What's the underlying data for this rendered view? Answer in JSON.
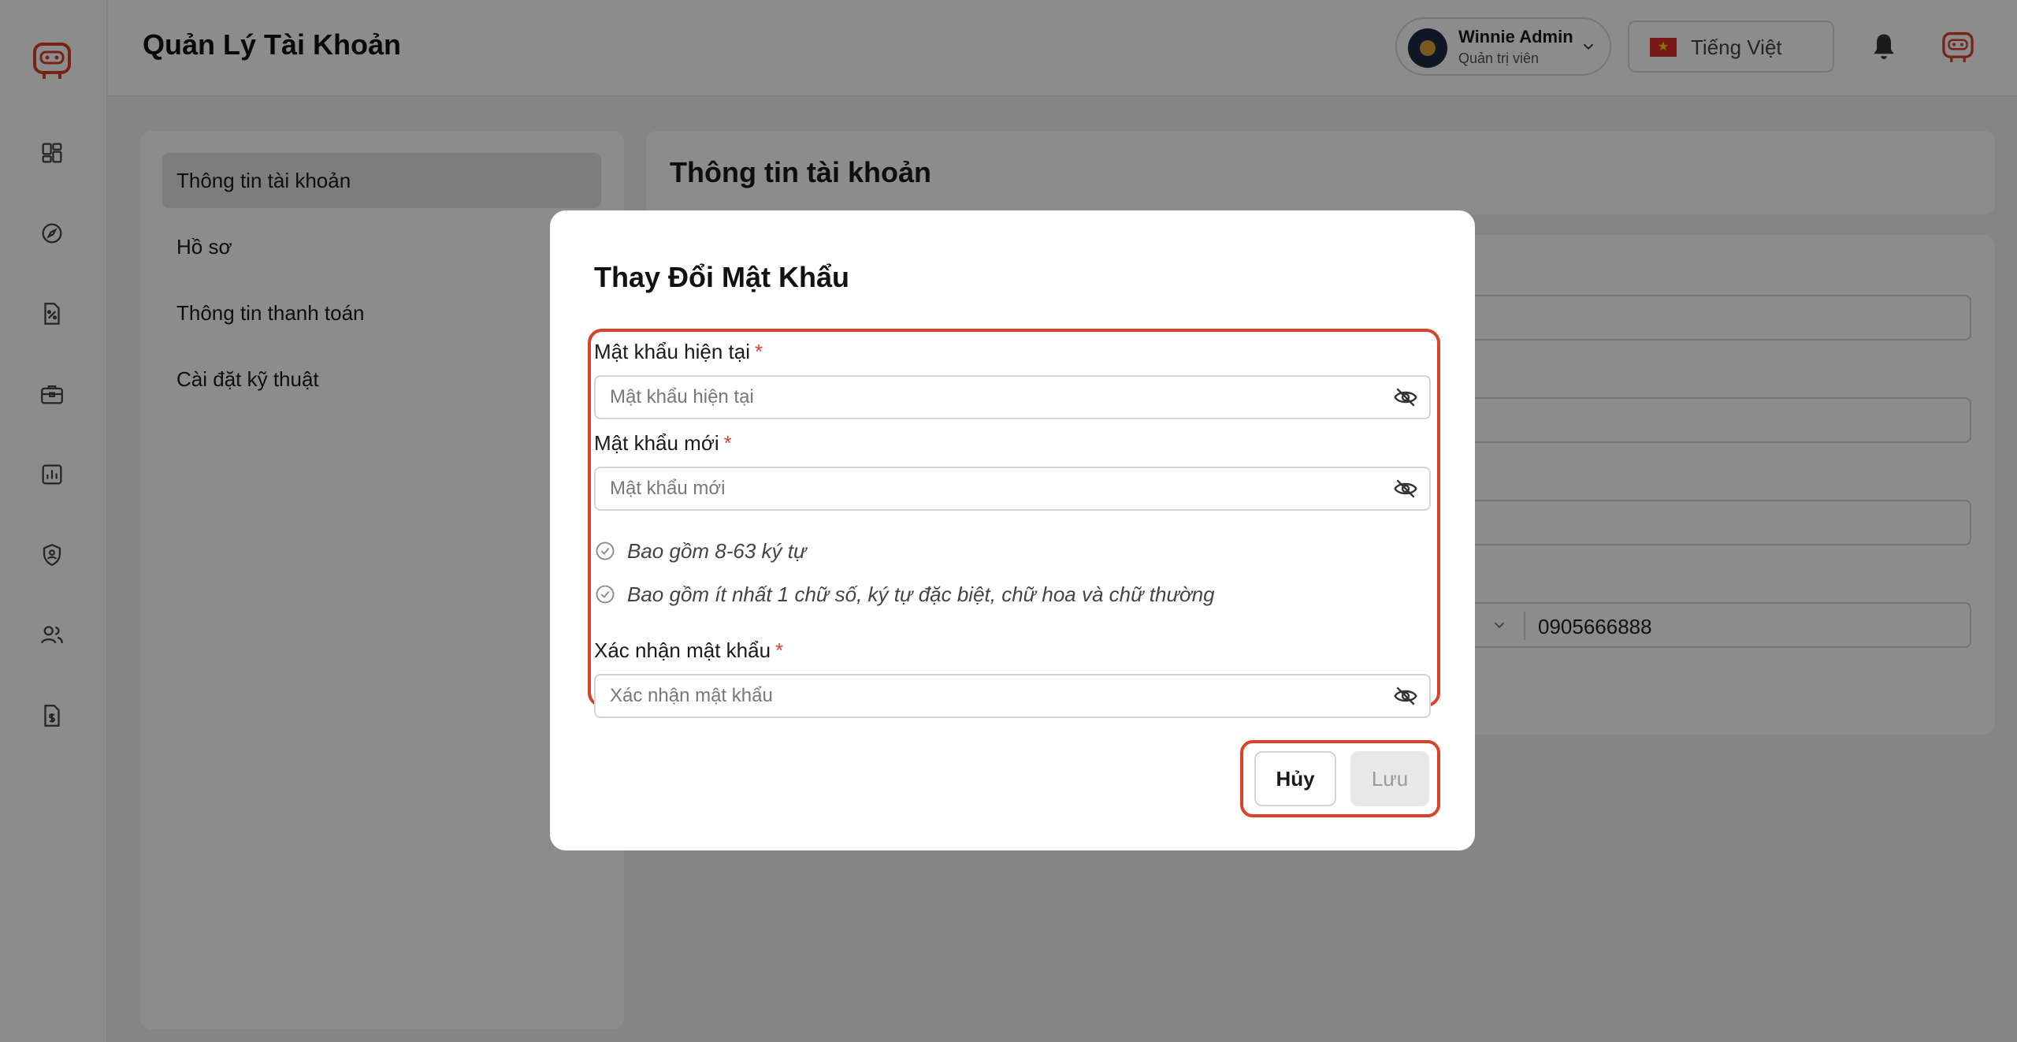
{
  "header": {
    "title": "Quản Lý Tài Khoản",
    "user": {
      "name": "Winnie Admin",
      "role": "Quản trị viên"
    },
    "language": "Tiếng Việt"
  },
  "sidebar": {
    "icons": [
      "dashboard-icon",
      "compass-icon",
      "discount-document-icon",
      "briefcase-icon",
      "report-chart-icon",
      "shield-user-icon",
      "users-icon",
      "invoice-icon"
    ]
  },
  "settings_menu": {
    "items": [
      {
        "label": "Thông tin tài khoản",
        "active": true
      },
      {
        "label": "Hồ sơ",
        "active": false
      },
      {
        "label": "Thông tin thanh toán",
        "active": false
      },
      {
        "label": "Cài đặt kỹ thuật",
        "active": false
      }
    ]
  },
  "content": {
    "title": "Thông tin tài khoản",
    "phone_value": "0905666888"
  },
  "modal": {
    "title": "Thay Đổi Mật Khẩu",
    "current_password": {
      "label": "Mật khẩu hiện tại",
      "required_mark": "*",
      "placeholder": "Mật khẩu hiện tại",
      "value": ""
    },
    "new_password": {
      "label": "Mật khẩu mới",
      "required_mark": "*",
      "placeholder": "Mật khẩu mới",
      "value": ""
    },
    "rules": [
      "Bao gồm 8-63 ký tự",
      "Bao gồm ít nhất 1 chữ số, ký tự đặc biệt, chữ hoa và chữ thường"
    ],
    "confirm_password": {
      "label": "Xác nhận mật khẩu",
      "required_mark": "*",
      "placeholder": "Xác nhận mật khẩu",
      "value": ""
    },
    "cancel_label": "Hủy",
    "save_label": "Lưu"
  },
  "colors": {
    "accent_red": "#d9432a",
    "overlay": "rgba(0,0,0,0.45)"
  }
}
